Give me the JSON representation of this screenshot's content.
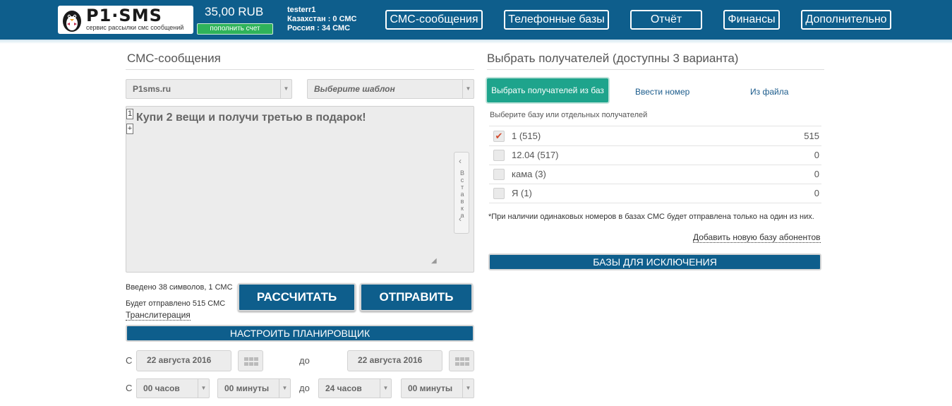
{
  "header": {
    "logo_text": "P1·SMS",
    "logo_sub": "сервис рассылки смс сообщений",
    "balance": "35,00 RUB",
    "topup_label": "пополнить счет",
    "username": "testerr1",
    "kz_line": "Казахстан : 0 СМС",
    "ru_line": "Россия : 34 СМС",
    "nav": [
      "СМС-сообщения",
      "Телефонные базы",
      "Отчёт",
      "Финансы",
      "Дополнительно"
    ]
  },
  "compose": {
    "title": "СМС-сообщения",
    "sender": "P1sms.ru",
    "template_placeholder": "Выберите шаблон",
    "line_number": "1",
    "add_line": "+",
    "message": "Купи 2 вещи и получи третью в подарок!",
    "insert_label": "Вставка",
    "chars_info": "Введено 38 символов, 1 СМС",
    "will_send": "Будет отправлено 515 СМС",
    "translit": "Транслитерация",
    "calc_btn": "РАССЧИТАТЬ",
    "send_btn": "ОТПРАВИТЬ",
    "scheduler_btn": "НАСТРОИТЬ ПЛАНИРОВЩИК",
    "from_label": "С",
    "to_label": "до",
    "date_from": "22 августа 2016",
    "date_to": "22 августа 2016",
    "hours_from": "00 часов",
    "minutes_from": "00 минуты",
    "hours_to": "24 часов",
    "minutes_to": "00 минуты"
  },
  "recipients": {
    "title": "Выбрать получателей (доступны 3 варианта)",
    "tabs": [
      "Выбрать получателей из баз",
      "Ввести номер",
      "Из файла"
    ],
    "hint": "Выберите базу или отдельных получателей",
    "rows": [
      {
        "label": "1 (515)",
        "count": "515",
        "checked": true
      },
      {
        "label": "12.04 (517)",
        "count": "0",
        "checked": false
      },
      {
        "label": "кама (3)",
        "count": "0",
        "checked": false
      },
      {
        "label": "Я (1)",
        "count": "0",
        "checked": false
      }
    ],
    "note": "*При наличии одинаковых номеров в базах СМС будет отправлена только на один из них.",
    "add_base": "Добавить новую базу абонентов",
    "exclude_btn": "БАЗЫ ДЛЯ ИСКЛЮЧЕНИЯ"
  },
  "colors": {
    "brand": "#0e5e8c",
    "accent_green": "#2fb35a",
    "tab_teal": "#1ea48c",
    "check_red": "#d24b2e"
  }
}
